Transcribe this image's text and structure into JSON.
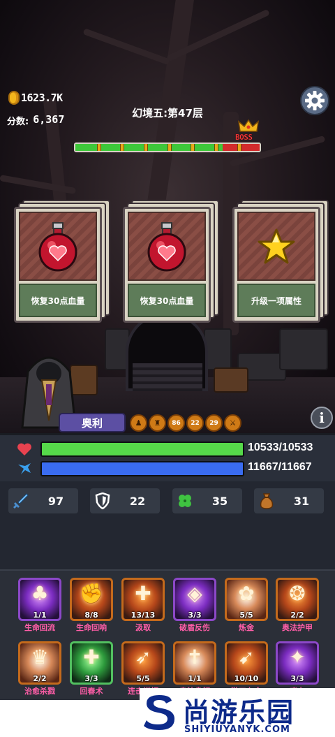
{
  "hud": {
    "coins": "1623.7K",
    "score_label": "分数:",
    "score": "6,367",
    "level_title": "幻境五:第47层",
    "boss_label": "BOSS",
    "settings_icon": "gear-icon"
  },
  "progress": {
    "fraction": 0.8,
    "markers": 7
  },
  "cards": [
    {
      "label": "恢复30点血量",
      "icon": "red-potion-icon"
    },
    {
      "label": "恢复30点血量",
      "icon": "red-potion-icon"
    },
    {
      "label": "升级一项属性",
      "icon": "star-icon"
    }
  ],
  "hero": {
    "name": "奥利",
    "buffs": [
      {
        "icon": "mage-icon",
        "value": ""
      },
      {
        "icon": "crown-icon",
        "value": ""
      },
      {
        "icon": "tower-icon",
        "value": "86"
      },
      {
        "icon": "house-icon",
        "value": "22"
      },
      {
        "icon": "flame-icon",
        "value": "29"
      },
      {
        "icon": "sword-icon",
        "value": ""
      }
    ]
  },
  "stats": {
    "hp": {
      "text": "10533/10533",
      "fraction": 1.0,
      "color": "#56d94a",
      "icon": "heart-icon"
    },
    "mp": {
      "text": "11667/11667",
      "fraction": 1.0,
      "color": "#3a6cf0",
      "icon": "bird-icon"
    },
    "attack": {
      "value": "97",
      "icon": "sword-icon"
    },
    "defense": {
      "value": "22",
      "icon": "shield-icon"
    },
    "luck": {
      "value": "35",
      "icon": "clover-icon"
    },
    "gold": {
      "value": "31",
      "icon": "money-bag-icon"
    }
  },
  "skills": [
    {
      "name": "生命回流",
      "count": "1/1",
      "style": "purple",
      "glyph": "♣",
      "icon": "life-flow-icon"
    },
    {
      "name": "生命回响",
      "count": "8/8",
      "style": "orange",
      "glyph": "✊",
      "icon": "life-echo-icon"
    },
    {
      "name": "汲取",
      "count": "13/13",
      "style": "orange",
      "glyph": "✚",
      "icon": "drain-icon"
    },
    {
      "name": "破盾反伤",
      "count": "3/3",
      "style": "purple",
      "glyph": "◈",
      "icon": "shield-break-icon"
    },
    {
      "name": "炼金",
      "count": "5/5",
      "style": "white",
      "glyph": "✿",
      "icon": "alchemy-icon"
    },
    {
      "name": "奥法护甲",
      "count": "2/2",
      "style": "orange",
      "glyph": "❂",
      "icon": "arcane-armor-icon"
    },
    {
      "name": "治愈杀戮",
      "count": "2/2",
      "style": "white",
      "glyph": "♛",
      "icon": "heal-slay-icon"
    },
    {
      "name": "回春术",
      "count": "3/3",
      "style": "green",
      "glyph": "✚",
      "icon": "rejuvenate-icon"
    },
    {
      "name": "连击增幅",
      "count": "5/5",
      "style": "orange",
      "glyph": "➶",
      "icon": "combo-icon"
    },
    {
      "name": "奥法身躯",
      "count": "1/1",
      "style": "white",
      "glyph": "✝",
      "icon": "arcane-body-icon"
    },
    {
      "name": "游刃有余",
      "count": "10/10",
      "style": "orange",
      "glyph": "➹",
      "icon": "dagger-icon"
    },
    {
      "name": "嗜血",
      "count": "3/3",
      "style": "purple",
      "glyph": "✦",
      "icon": "bloodlust-icon"
    }
  ],
  "watermark": {
    "cn": "尚游乐园",
    "en": "SHIYIUYANYK.COM"
  }
}
